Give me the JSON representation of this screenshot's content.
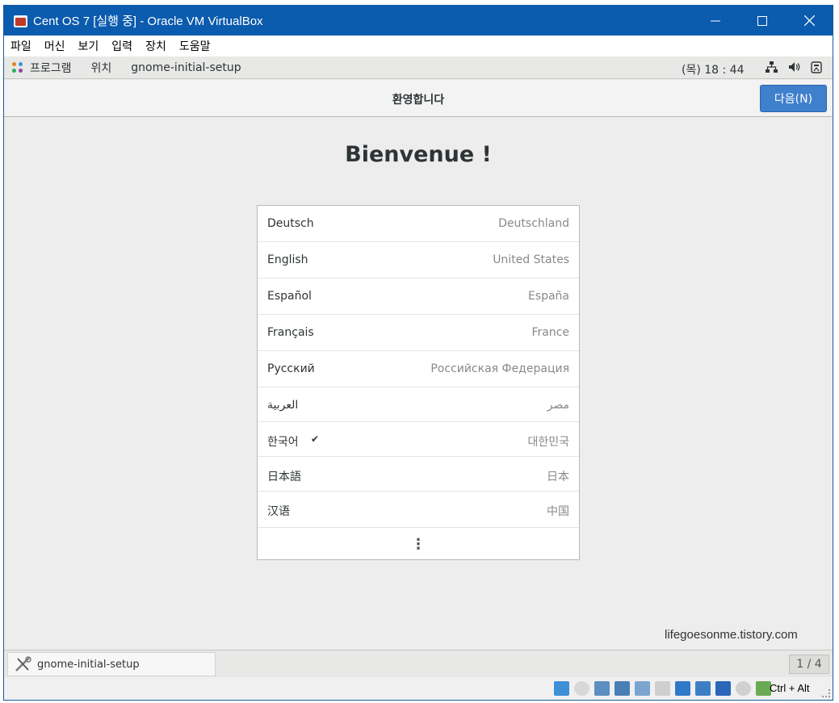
{
  "window": {
    "title": "Cent OS 7 [실행 중] - Oracle VM VirtualBox"
  },
  "menu": {
    "items": [
      "파일",
      "머신",
      "보기",
      "입력",
      "장치",
      "도움말"
    ]
  },
  "gnome_top": {
    "apps_label": "프로그램",
    "places_label": "위치",
    "app_name": "gnome-initial-setup",
    "clock": "(목) 18 : 44"
  },
  "setup": {
    "header_title": "환영합니다",
    "next_label": "다음(N)",
    "welcome": "Bienvenue !",
    "languages": [
      {
        "name": "Deutsch",
        "country": "Deutschland",
        "selected": false
      },
      {
        "name": "English",
        "country": "United States",
        "selected": false
      },
      {
        "name": "Español",
        "country": "España",
        "selected": false
      },
      {
        "name": "Français",
        "country": "France",
        "selected": false
      },
      {
        "name": "Русский",
        "country": "Российская Федерация",
        "selected": false
      },
      {
        "name": "العربية",
        "country": "مصر",
        "selected": false
      },
      {
        "name": "한국어",
        "country": "대한민국",
        "selected": true
      },
      {
        "name": "日本語",
        "country": "日本",
        "selected": false
      },
      {
        "name": "汉语",
        "country": "中国",
        "selected": false
      }
    ],
    "check_mark": "✔",
    "more_icon": "⋮"
  },
  "watermark": "lifegoesonme.tistory.com",
  "gnome_bottom": {
    "task_label": "gnome-initial-setup",
    "pager": "1 / 4"
  },
  "vbox_status": {
    "host_key": "Ctrl + Alt"
  },
  "colors": {
    "titlebar": "#0b5bae",
    "accent": "#3f80cd"
  }
}
